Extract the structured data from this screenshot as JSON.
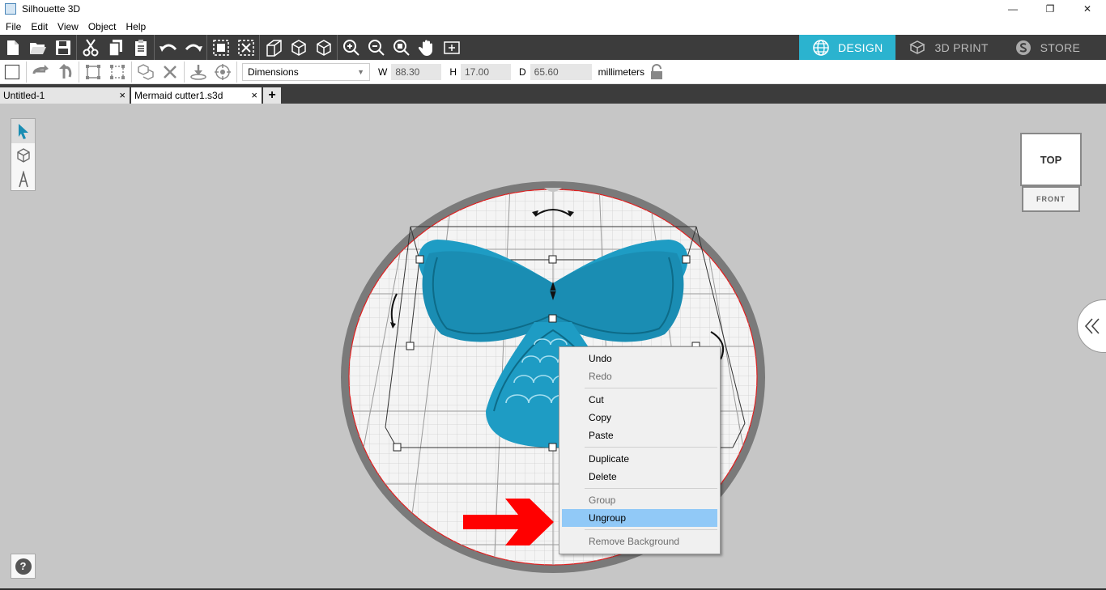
{
  "window": {
    "title": "Silhouette 3D",
    "minimize": "—",
    "restore": "❐",
    "close": "✕"
  },
  "menu": [
    "File",
    "Edit",
    "View",
    "Object",
    "Help"
  ],
  "modes": {
    "design": "DESIGN",
    "print": "3D PRINT",
    "store": "STORE"
  },
  "dimensions": {
    "dropdown": "Dimensions",
    "w_label": "W",
    "w_value": "88.30",
    "h_label": "H",
    "h_value": "17.00",
    "d_label": "D",
    "d_value": "65.60",
    "unit": "millimeters"
  },
  "tabs": [
    {
      "label": "Untitled-1",
      "close": "×"
    },
    {
      "label": "Mermaid cutter1.s3d",
      "close": "×"
    }
  ],
  "tab_add": "+",
  "navcube": {
    "top": "TOP",
    "front": "FRONT"
  },
  "help": "?",
  "context_menu": {
    "undo": "Undo",
    "redo": "Redo",
    "cut": "Cut",
    "copy": "Copy",
    "paste": "Paste",
    "duplicate": "Duplicate",
    "delete": "Delete",
    "group": "Group",
    "ungroup": "Ungroup",
    "remove_background": "Remove Background"
  },
  "colors": {
    "accent": "#2bb3cf",
    "model": "#1e9cc4",
    "highlight": "#91c9f7",
    "arrow": "#ff0000"
  }
}
